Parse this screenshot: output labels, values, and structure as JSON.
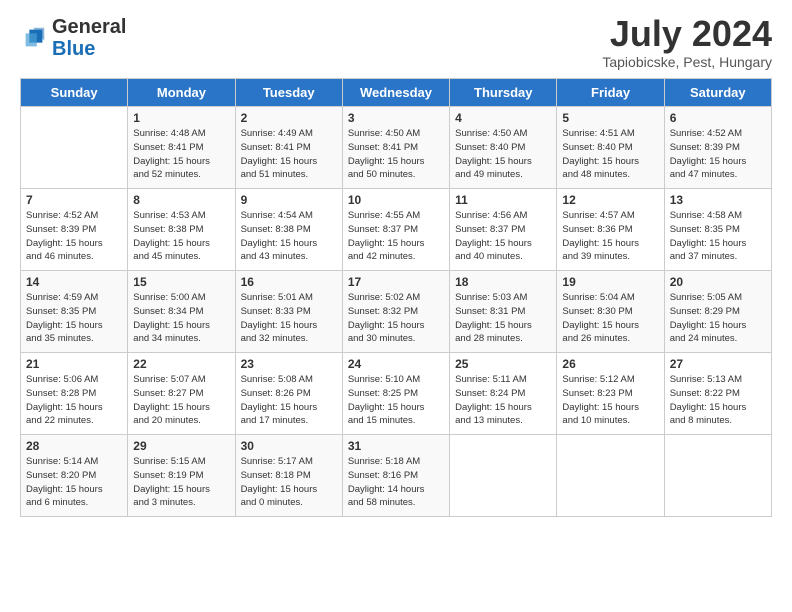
{
  "header": {
    "logo_general": "General",
    "logo_blue": "Blue",
    "title": "July 2024",
    "location": "Tapiobicske, Pest, Hungary"
  },
  "days_of_week": [
    "Sunday",
    "Monday",
    "Tuesday",
    "Wednesday",
    "Thursday",
    "Friday",
    "Saturday"
  ],
  "weeks": [
    [
      {
        "day": "",
        "info": ""
      },
      {
        "day": "1",
        "info": "Sunrise: 4:48 AM\nSunset: 8:41 PM\nDaylight: 15 hours\nand 52 minutes."
      },
      {
        "day": "2",
        "info": "Sunrise: 4:49 AM\nSunset: 8:41 PM\nDaylight: 15 hours\nand 51 minutes."
      },
      {
        "day": "3",
        "info": "Sunrise: 4:50 AM\nSunset: 8:41 PM\nDaylight: 15 hours\nand 50 minutes."
      },
      {
        "day": "4",
        "info": "Sunrise: 4:50 AM\nSunset: 8:40 PM\nDaylight: 15 hours\nand 49 minutes."
      },
      {
        "day": "5",
        "info": "Sunrise: 4:51 AM\nSunset: 8:40 PM\nDaylight: 15 hours\nand 48 minutes."
      },
      {
        "day": "6",
        "info": "Sunrise: 4:52 AM\nSunset: 8:39 PM\nDaylight: 15 hours\nand 47 minutes."
      }
    ],
    [
      {
        "day": "7",
        "info": "Sunrise: 4:52 AM\nSunset: 8:39 PM\nDaylight: 15 hours\nand 46 minutes."
      },
      {
        "day": "8",
        "info": "Sunrise: 4:53 AM\nSunset: 8:38 PM\nDaylight: 15 hours\nand 45 minutes."
      },
      {
        "day": "9",
        "info": "Sunrise: 4:54 AM\nSunset: 8:38 PM\nDaylight: 15 hours\nand 43 minutes."
      },
      {
        "day": "10",
        "info": "Sunrise: 4:55 AM\nSunset: 8:37 PM\nDaylight: 15 hours\nand 42 minutes."
      },
      {
        "day": "11",
        "info": "Sunrise: 4:56 AM\nSunset: 8:37 PM\nDaylight: 15 hours\nand 40 minutes."
      },
      {
        "day": "12",
        "info": "Sunrise: 4:57 AM\nSunset: 8:36 PM\nDaylight: 15 hours\nand 39 minutes."
      },
      {
        "day": "13",
        "info": "Sunrise: 4:58 AM\nSunset: 8:35 PM\nDaylight: 15 hours\nand 37 minutes."
      }
    ],
    [
      {
        "day": "14",
        "info": "Sunrise: 4:59 AM\nSunset: 8:35 PM\nDaylight: 15 hours\nand 35 minutes."
      },
      {
        "day": "15",
        "info": "Sunrise: 5:00 AM\nSunset: 8:34 PM\nDaylight: 15 hours\nand 34 minutes."
      },
      {
        "day": "16",
        "info": "Sunrise: 5:01 AM\nSunset: 8:33 PM\nDaylight: 15 hours\nand 32 minutes."
      },
      {
        "day": "17",
        "info": "Sunrise: 5:02 AM\nSunset: 8:32 PM\nDaylight: 15 hours\nand 30 minutes."
      },
      {
        "day": "18",
        "info": "Sunrise: 5:03 AM\nSunset: 8:31 PM\nDaylight: 15 hours\nand 28 minutes."
      },
      {
        "day": "19",
        "info": "Sunrise: 5:04 AM\nSunset: 8:30 PM\nDaylight: 15 hours\nand 26 minutes."
      },
      {
        "day": "20",
        "info": "Sunrise: 5:05 AM\nSunset: 8:29 PM\nDaylight: 15 hours\nand 24 minutes."
      }
    ],
    [
      {
        "day": "21",
        "info": "Sunrise: 5:06 AM\nSunset: 8:28 PM\nDaylight: 15 hours\nand 22 minutes."
      },
      {
        "day": "22",
        "info": "Sunrise: 5:07 AM\nSunset: 8:27 PM\nDaylight: 15 hours\nand 20 minutes."
      },
      {
        "day": "23",
        "info": "Sunrise: 5:08 AM\nSunset: 8:26 PM\nDaylight: 15 hours\nand 17 minutes."
      },
      {
        "day": "24",
        "info": "Sunrise: 5:10 AM\nSunset: 8:25 PM\nDaylight: 15 hours\nand 15 minutes."
      },
      {
        "day": "25",
        "info": "Sunrise: 5:11 AM\nSunset: 8:24 PM\nDaylight: 15 hours\nand 13 minutes."
      },
      {
        "day": "26",
        "info": "Sunrise: 5:12 AM\nSunset: 8:23 PM\nDaylight: 15 hours\nand 10 minutes."
      },
      {
        "day": "27",
        "info": "Sunrise: 5:13 AM\nSunset: 8:22 PM\nDaylight: 15 hours\nand 8 minutes."
      }
    ],
    [
      {
        "day": "28",
        "info": "Sunrise: 5:14 AM\nSunset: 8:20 PM\nDaylight: 15 hours\nand 6 minutes."
      },
      {
        "day": "29",
        "info": "Sunrise: 5:15 AM\nSunset: 8:19 PM\nDaylight: 15 hours\nand 3 minutes."
      },
      {
        "day": "30",
        "info": "Sunrise: 5:17 AM\nSunset: 8:18 PM\nDaylight: 15 hours\nand 0 minutes."
      },
      {
        "day": "31",
        "info": "Sunrise: 5:18 AM\nSunset: 8:16 PM\nDaylight: 14 hours\nand 58 minutes."
      },
      {
        "day": "",
        "info": ""
      },
      {
        "day": "",
        "info": ""
      },
      {
        "day": "",
        "info": ""
      }
    ]
  ]
}
